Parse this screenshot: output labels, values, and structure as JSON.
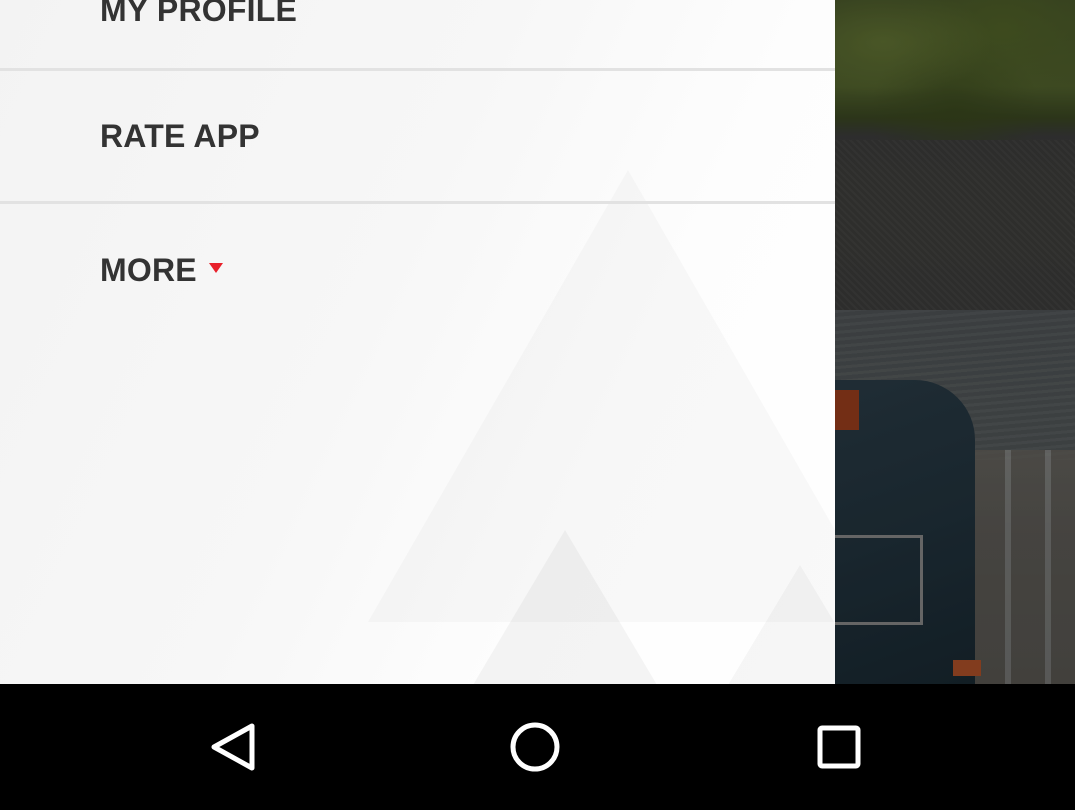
{
  "drawer": {
    "items": [
      {
        "label": "MY PROFILE"
      },
      {
        "label": "RATE APP"
      },
      {
        "label": "MORE"
      }
    ],
    "more_caret_color": "#e8202a"
  },
  "navbar": {
    "back_icon": "back-triangle-icon",
    "home_icon": "home-circle-icon",
    "recents_icon": "recents-square-icon"
  }
}
